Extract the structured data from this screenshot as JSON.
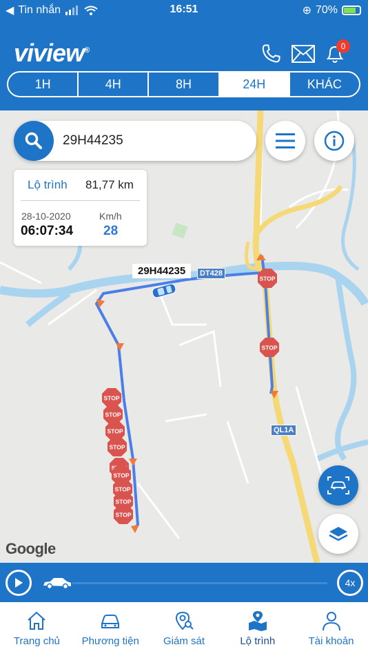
{
  "status_bar": {
    "back_app": "Tin nhắn",
    "time": "16:51",
    "battery": "70%"
  },
  "header": {
    "logo": "viview",
    "logo_mark": "®",
    "notification_count": "0",
    "icons": [
      "phone-icon",
      "mail-icon",
      "bell-icon"
    ]
  },
  "range_tabs": [
    {
      "label": "1H",
      "active": false
    },
    {
      "label": "4H",
      "active": false
    },
    {
      "label": "8H",
      "active": false
    },
    {
      "label": "24H",
      "active": true
    },
    {
      "label": "KHÁC",
      "active": false
    }
  ],
  "search": {
    "value": "29H44235"
  },
  "info_card": {
    "route_label": "Lộ trình",
    "route_value": "81,77 km",
    "date": "28-10-2020",
    "time": "06:07:34",
    "speed_label": "Km/h",
    "speed_value": "28"
  },
  "map": {
    "vehicle_label": "29H44235",
    "road_labels": [
      "DT428",
      "QL1A"
    ],
    "stop_label": "STOP",
    "attribution": "Google"
  },
  "playback": {
    "speed": "4x"
  },
  "bottom_nav": [
    {
      "label": "Trang chủ",
      "icon": "home-icon",
      "active": false
    },
    {
      "label": "Phương tiện",
      "icon": "car-icon",
      "active": false
    },
    {
      "label": "Giám sát",
      "icon": "monitor-search-icon",
      "active": false
    },
    {
      "label": "Lộ trình",
      "icon": "route-icon",
      "active": true
    },
    {
      "label": "Tài khoản",
      "icon": "user-icon",
      "active": false
    }
  ],
  "colors": {
    "primary": "#1e74c6",
    "route": "#4a7fe8",
    "stop": "#d9534f",
    "arrow": "#f07a3a",
    "water": "#a8d4f0"
  }
}
